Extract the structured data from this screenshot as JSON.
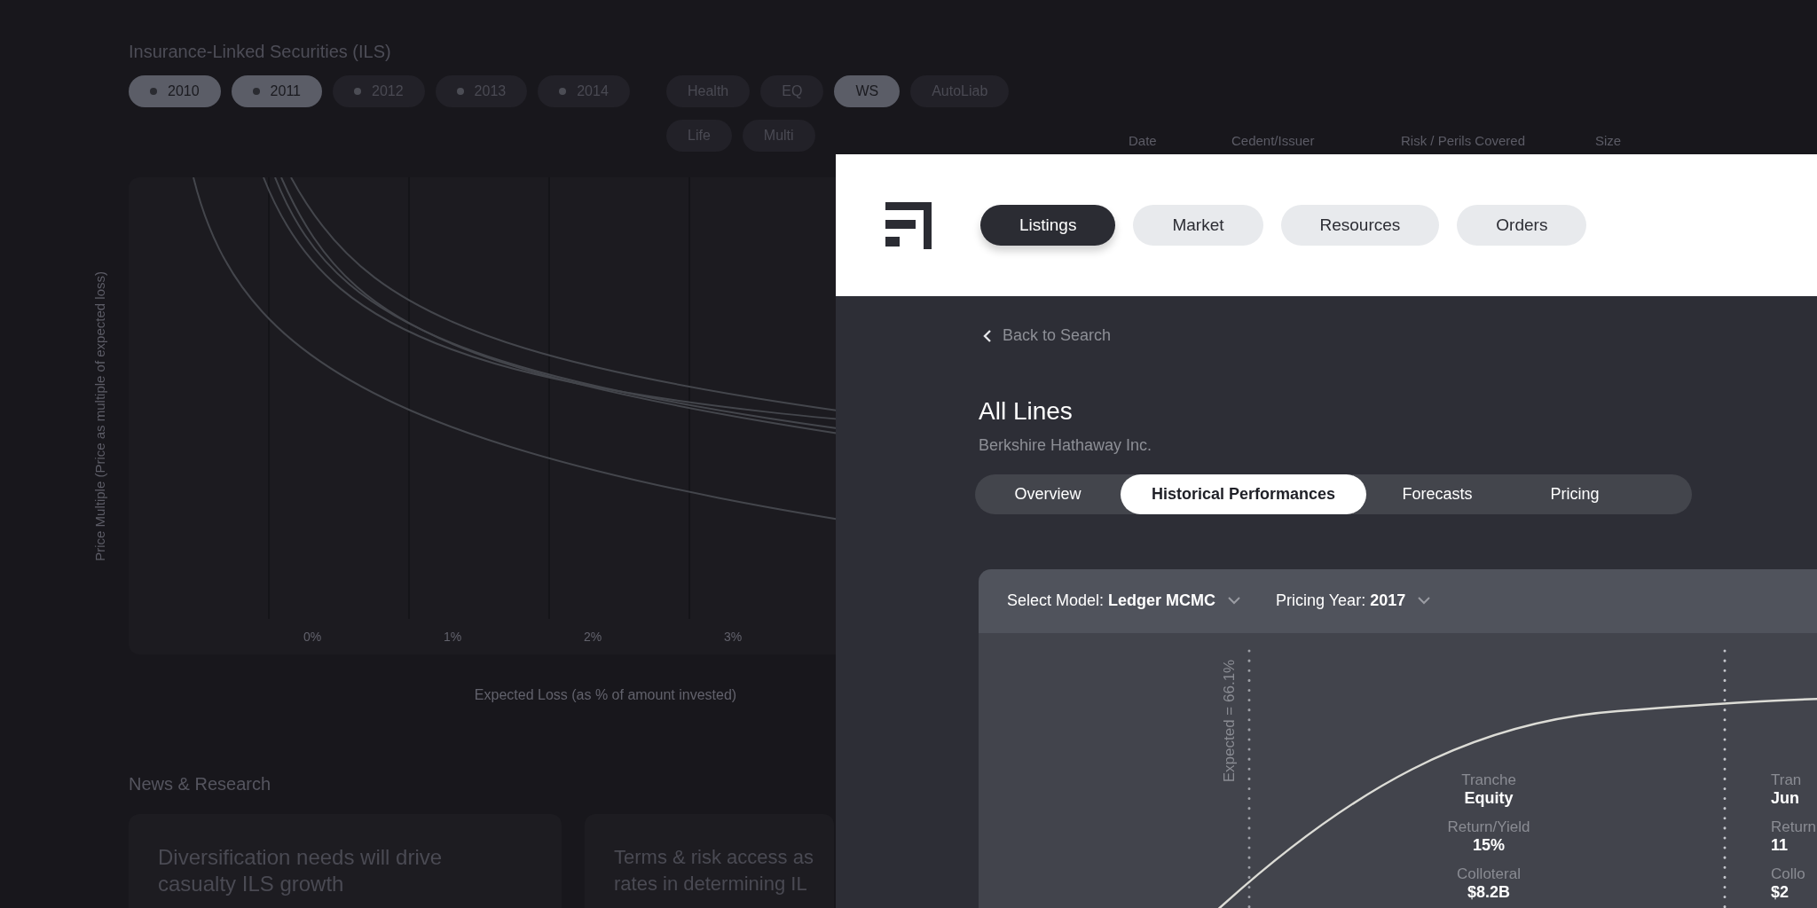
{
  "page": {
    "title": "Insurance-Linked Securities (ILS)",
    "years": [
      {
        "label": "2010",
        "selected": true
      },
      {
        "label": "2011",
        "selected": true
      },
      {
        "label": "2012",
        "selected": false
      },
      {
        "label": "2013",
        "selected": false
      },
      {
        "label": "2014",
        "selected": false
      }
    ],
    "categories": [
      {
        "label": "Health",
        "selected": false
      },
      {
        "label": "EQ",
        "selected": false
      },
      {
        "label": "WS",
        "selected": true
      },
      {
        "label": "AutoLiab",
        "selected": false
      },
      {
        "label": "Life",
        "selected": false
      },
      {
        "label": "Multi",
        "selected": false
      }
    ],
    "table": {
      "columns": [
        "Date",
        "Cedent/Issuer",
        "Risk / Perils Covered",
        "Size"
      ]
    },
    "chart": {
      "ylabel": "Price Multiple (Price as multiple of expected loss)",
      "xticks": [
        "0%",
        "1%",
        "2%",
        "3%"
      ],
      "xlabel": "Expected Loss (as % of amount invested)"
    },
    "news": {
      "title": "News & Research",
      "cards": [
        {
          "lines": [
            "Diversification needs will drive",
            "casualty ILS growth"
          ]
        },
        {
          "lines": [
            "Terms & risk access as",
            "rates in determining IL"
          ]
        }
      ]
    }
  },
  "detail": {
    "nav": [
      {
        "label": "Listings",
        "selected": true
      },
      {
        "label": "Market",
        "selected": false
      },
      {
        "label": "Resources",
        "selected": false
      },
      {
        "label": "Orders",
        "selected": false
      }
    ],
    "back_link": "Back to Search",
    "title": "All Lines",
    "subtitle": "Berkshire Hathaway Inc.",
    "tabs": [
      {
        "label": "Overview",
        "selected": false
      },
      {
        "label": "Historical Performances",
        "selected": true
      },
      {
        "label": "Forecasts",
        "selected": false
      },
      {
        "label": "Pricing",
        "selected": false
      }
    ],
    "model_select": "Select Model: **Ledger MCMC**",
    "year_select": "Pricing Year: **2017**",
    "expected_label": "Expected = 66.1%",
    "tranches": [
      {
        "stats": [
          {
            "label": "Tranche",
            "value": "Equity"
          },
          {
            "label": "Return/Yield",
            "value": "15%"
          },
          {
            "label": "Colloteral",
            "value": "$8.2B"
          }
        ]
      },
      {
        "stats": [
          {
            "label": "Tran",
            "value": "Jun"
          },
          {
            "label": "Return",
            "value": "11"
          },
          {
            "label": "Collo",
            "value": "$2"
          }
        ]
      }
    ]
  }
}
